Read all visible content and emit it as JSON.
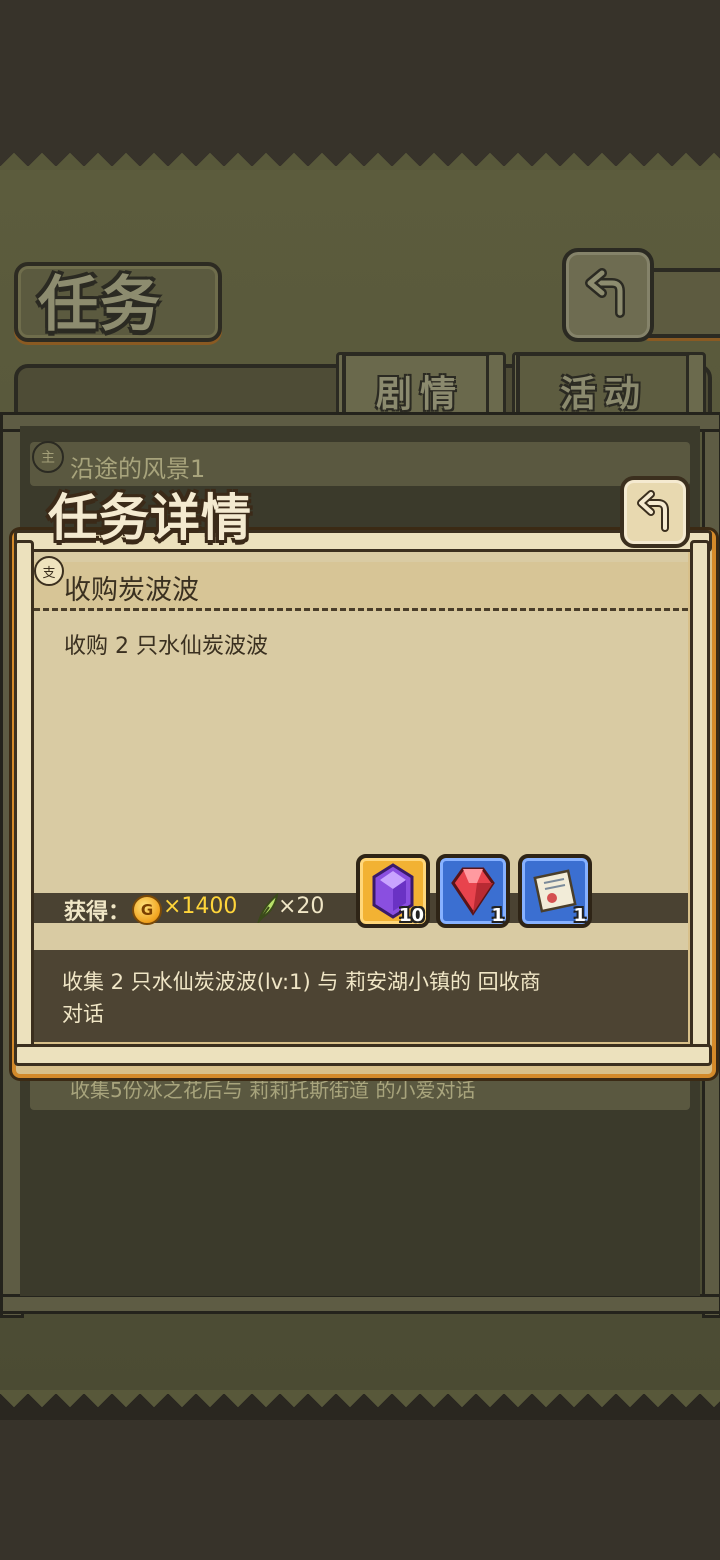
{
  "page": {
    "title": "任务"
  },
  "tabs": [
    {
      "label": "剧情",
      "active": true
    },
    {
      "label": "活动",
      "active": false
    }
  ],
  "quest_list": [
    {
      "badge": "主",
      "title": "沿途的风景1"
    },
    {
      "title": "收集5份冰之花后与 莉莉托斯街道 的小爱对话"
    }
  ],
  "detail": {
    "heading": "任务详情",
    "badge": "支",
    "quest_name": "收购炭波波",
    "description": "收购 2 只水仙炭波波",
    "reward_label": "获得：",
    "coin_icon_glyph": "G",
    "coin_amount": "×1400",
    "quill_amount": "×20",
    "items": [
      {
        "name": "purple-crystal",
        "count": "10",
        "frame": "gold"
      },
      {
        "name": "red-gem",
        "count": "1",
        "frame": "blue"
      },
      {
        "name": "scroll",
        "count": "1",
        "frame": "blue"
      }
    ],
    "hint": "收集 2 只水仙炭波波(lv:1) 与 莉安湖小镇的 回收商 对话"
  },
  "colors": {
    "accent_orange": "#d48a2a",
    "coin_text": "#ffd53a",
    "rare_blue": "#3b6fd1",
    "epic_gold": "#f2b233"
  }
}
